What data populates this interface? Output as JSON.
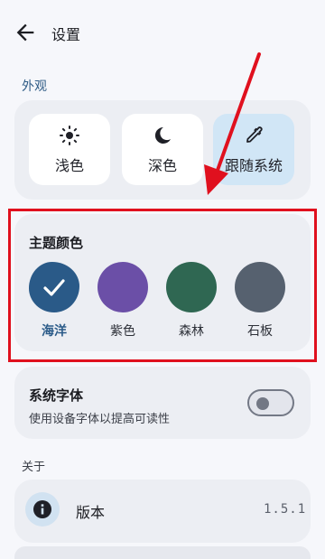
{
  "header": {
    "title": "设置"
  },
  "appearance": {
    "section_label": "外观",
    "modes": [
      {
        "label": "浅色",
        "icon": "sun-icon",
        "selected": false
      },
      {
        "label": "深色",
        "icon": "moon-icon",
        "selected": false
      },
      {
        "label": "跟随系统",
        "icon": "eyedropper-icon",
        "selected": true
      }
    ]
  },
  "theme": {
    "title": "主题颜色",
    "colors": [
      {
        "label": "海洋",
        "hex": "#2a5a88",
        "selected": true
      },
      {
        "label": "紫色",
        "hex": "#6b4fa7",
        "selected": false
      },
      {
        "label": "森林",
        "hex": "#2f6752",
        "selected": false
      },
      {
        "label": "石板",
        "hex": "#56616f",
        "selected": false
      }
    ]
  },
  "system_font": {
    "title": "系统字体",
    "description": "使用设备字体以提高可读性",
    "enabled": false
  },
  "about": {
    "section_label": "关于",
    "version_label": "版本",
    "version_value": "1.5.1"
  },
  "annotation_colors": {
    "highlight_box": "#e0101e",
    "arrow": "#e0101e"
  }
}
